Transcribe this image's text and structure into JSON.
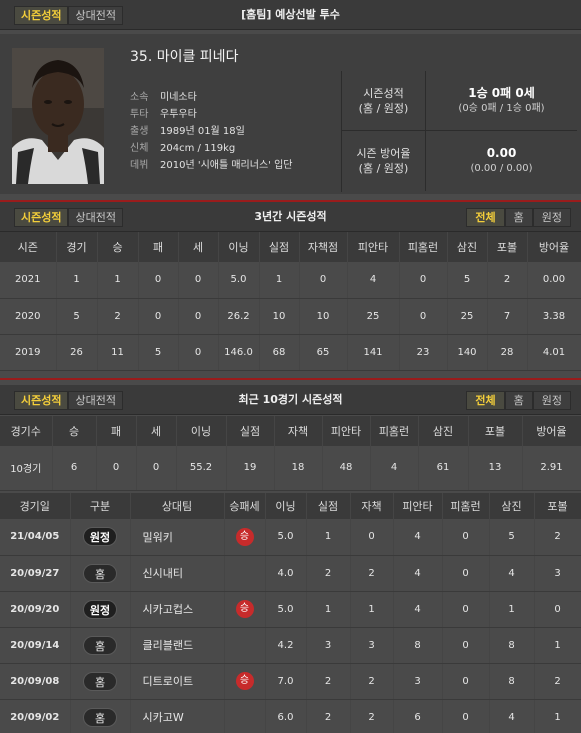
{
  "header": {
    "tabs": [
      "시즌성적",
      "상대전적"
    ],
    "title": "[홈팀] 예상선발 투수"
  },
  "player": {
    "name": "35. 마이클 피네다",
    "info": [
      {
        "key": "소속",
        "value": "미네소타"
      },
      {
        "key": "투타",
        "value": "우투우타"
      },
      {
        "key": "출생",
        "value": "1989년 01월 18일"
      },
      {
        "key": "신체",
        "value": "204cm / 119kg"
      },
      {
        "key": "데뷔",
        "value": "2010년 '시애틀 매리너스' 입단"
      }
    ],
    "summary": [
      {
        "label1": "시즌성적",
        "label2": "(홈 / 원정)",
        "main": "1승 0패 0세",
        "sub": "(0승 0패 / 1승 0패)"
      },
      {
        "label1": "시즌 방어율",
        "label2": "(홈 / 원정)",
        "main": "0.00",
        "sub": "(0.00 / 0.00)"
      }
    ]
  },
  "season3": {
    "tabs": [
      "시즌성적",
      "상대전적"
    ],
    "title": "3년간 시즌성적",
    "filters": [
      "전체",
      "홈",
      "원정"
    ],
    "columns": [
      "시즌",
      "경기",
      "승",
      "패",
      "세",
      "이닝",
      "실점",
      "자책점",
      "피안타",
      "피홈런",
      "삼진",
      "포볼",
      "방어율"
    ],
    "rows": [
      [
        "2021",
        "1",
        "1",
        "0",
        "0",
        "5.0",
        "1",
        "0",
        "4",
        "0",
        "5",
        "2",
        "0.00"
      ],
      [
        "2020",
        "5",
        "2",
        "0",
        "0",
        "26.2",
        "10",
        "10",
        "25",
        "0",
        "25",
        "7",
        "3.38"
      ],
      [
        "2019",
        "26",
        "11",
        "5",
        "0",
        "146.0",
        "68",
        "65",
        "141",
        "23",
        "140",
        "28",
        "4.01"
      ]
    ]
  },
  "recent10": {
    "tabs": [
      "시즌성적",
      "상대전적"
    ],
    "title": "최근 10경기 시즌성적",
    "filters": [
      "전체",
      "홈",
      "원정"
    ],
    "columns": [
      "경기수",
      "승",
      "패",
      "세",
      "이닝",
      "실점",
      "자책",
      "피안타",
      "피홈런",
      "삼진",
      "포볼",
      "방어율"
    ],
    "row": [
      "10경기",
      "6",
      "0",
      "0",
      "55.2",
      "19",
      "18",
      "48",
      "4",
      "61",
      "13",
      "2.91"
    ]
  },
  "games": {
    "columns": [
      "경기일",
      "구분",
      "상대팀",
      "승패세",
      "이닝",
      "실점",
      "자책",
      "피안타",
      "피홈런",
      "삼진",
      "포볼"
    ],
    "rows": [
      {
        "date": "21/04/05",
        "type": "원정",
        "opp": "밀워키",
        "result": "승",
        "stats": [
          "5.0",
          "1",
          "0",
          "4",
          "0",
          "5",
          "2"
        ]
      },
      {
        "date": "20/09/27",
        "type": "홈",
        "opp": "신시내티",
        "result": "",
        "stats": [
          "4.0",
          "2",
          "2",
          "4",
          "0",
          "4",
          "3"
        ]
      },
      {
        "date": "20/09/20",
        "type": "원정",
        "opp": "시카고컵스",
        "result": "승",
        "stats": [
          "5.0",
          "1",
          "1",
          "4",
          "0",
          "1",
          "0"
        ]
      },
      {
        "date": "20/09/14",
        "type": "홈",
        "opp": "클리블랜드",
        "result": "",
        "stats": [
          "4.2",
          "3",
          "3",
          "8",
          "0",
          "8",
          "1"
        ]
      },
      {
        "date": "20/09/08",
        "type": "홈",
        "opp": "디트로이트",
        "result": "승",
        "stats": [
          "7.0",
          "2",
          "2",
          "3",
          "0",
          "8",
          "2"
        ]
      },
      {
        "date": "20/09/02",
        "type": "홈",
        "opp": "시카고W",
        "result": "",
        "stats": [
          "6.0",
          "2",
          "2",
          "6",
          "0",
          "4",
          "1"
        ]
      }
    ]
  }
}
